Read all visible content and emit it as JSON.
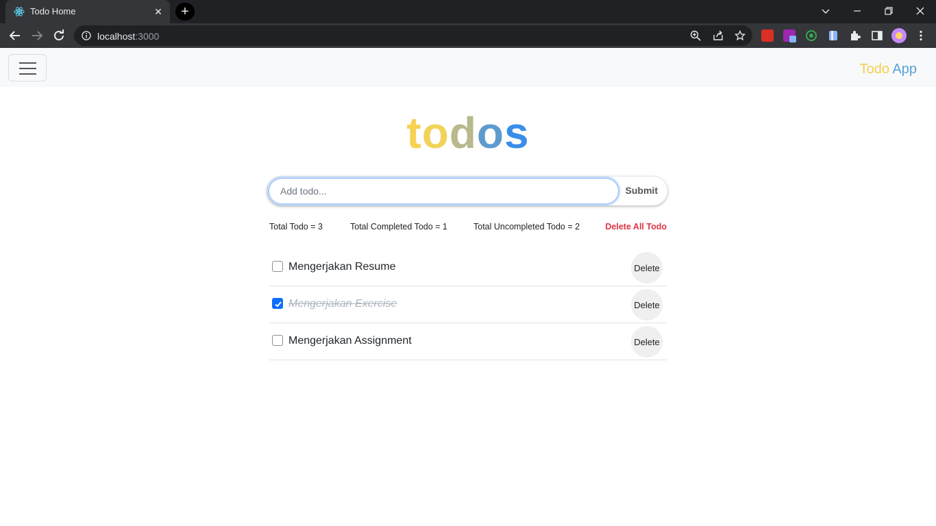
{
  "browser": {
    "tab_title": "Todo Home",
    "tab_close": "✕",
    "new_tab": "+",
    "url_host": "localhost",
    "url_port": ":3000",
    "icons": [
      "react-favicon",
      "back-arrow-icon",
      "forward-arrow-icon",
      "reload-icon",
      "info-icon",
      "zoom-icon",
      "share-icon",
      "star-icon",
      "extension-icon",
      "puzzle-icon",
      "sidepanel-icon",
      "avatar",
      "kebab-menu-icon"
    ]
  },
  "navbar": {
    "brand_part1": "Todo",
    "brand_part2": "App",
    "brand_color1": "#f5cf4e",
    "brand_color2": "#56a1d6"
  },
  "title": {
    "letters": [
      "t",
      "o",
      "d",
      "o",
      "s"
    ],
    "colors": [
      "#f7d154",
      "#f2d35a",
      "#b8b98c",
      "#5d9bcf",
      "#3a8ee8"
    ]
  },
  "form": {
    "placeholder": "Add todo...",
    "submit_label": "Submit"
  },
  "stats": {
    "total": "Total Todo = 3",
    "completed": "Total Completed Todo = 1",
    "uncompleted": "Total Uncompleted Todo = 2",
    "delete_all": "Delete All Todo"
  },
  "todos": [
    {
      "text": "Mengerjakan Resume",
      "completed": false,
      "delete_label": "Delete"
    },
    {
      "text": "Mengerjakan Exercise",
      "completed": true,
      "delete_label": "Delete"
    },
    {
      "text": "Mengerjakan Assignment",
      "completed": false,
      "delete_label": "Delete"
    }
  ],
  "colors": {
    "accent": "#0d6efd",
    "danger": "#dc3545"
  }
}
